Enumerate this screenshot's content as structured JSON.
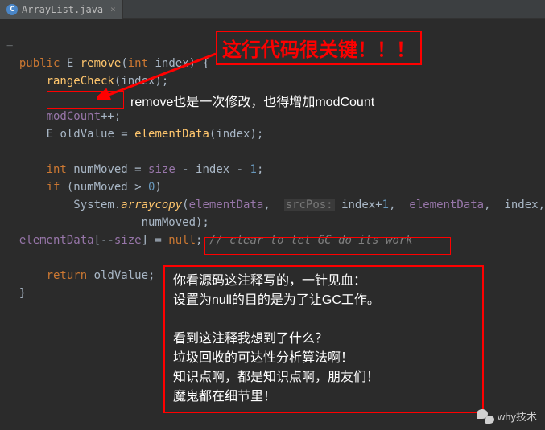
{
  "tab": {
    "filename": "ArrayList.java",
    "icon_letter": "C"
  },
  "code": {
    "line1_public": "public",
    "line1_E": "E",
    "line1_remove": "remove",
    "line1_int": "int",
    "line1_index": "index",
    "line2_rangeCheck": "rangeCheck",
    "line2_index": "index",
    "line4_modCount": "modCount",
    "line4_pp": "++",
    "line5_E": "E",
    "line5_oldValue": "oldValue",
    "line5_elementData": "elementData",
    "line5_index": "index",
    "line7_int": "int",
    "line7_numMoved": "numMoved",
    "line7_size": "size",
    "line7_index": "index",
    "line7_minus1": "1",
    "line8_if": "if",
    "line8_numMoved": "numMoved",
    "line8_zero": "0",
    "line9_System": "System",
    "line9_arraycopy": "arraycopy",
    "line9_elementData1": "elementData",
    "line9_srcPos": "srcPos:",
    "line9_index": "index",
    "line9_plus1": "1",
    "line9_elementData2": "elementData",
    "line9_index2": "index",
    "line10_numMoved": "numMoved",
    "line11_elementData": "elementData",
    "line11_size": "size",
    "line11_null": "null",
    "line11_comment": "// clear to let GC do its work",
    "line13_return": "return",
    "line13_oldValue": "oldValue"
  },
  "callouts": {
    "critical_line": "这行代码很关键！！！",
    "remove_annotation": "remove也是一次修改，也得增加modCount",
    "big_comment": "你看源码这注释写的，一针见血：\n设置为null的目的是为了让GC工作。\n\n看到这注释我想到了什么？\n垃圾回收的可达性分析算法啊！\n知识点啊，都是知识点啊，朋友们！\n魔鬼都在细节里！"
  },
  "watermark": {
    "text": "why技术"
  }
}
